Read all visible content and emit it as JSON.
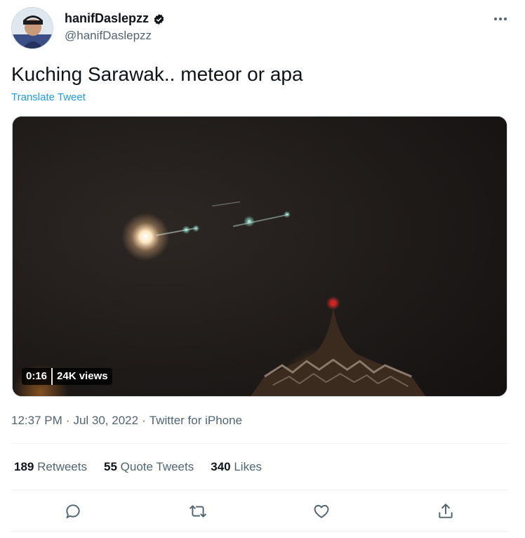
{
  "user": {
    "display_name": "hanifDaslepzz",
    "handle": "@hanifDaslepzz",
    "verified": true,
    "avatar_icon": "avatar-photo"
  },
  "tweet": {
    "text": "Kuching Sarawak.. meteor or apa",
    "translate_label": "Translate Tweet"
  },
  "media": {
    "duration": "0:16",
    "views": "24K views"
  },
  "meta": {
    "time": "12:37 PM",
    "separator1": "·",
    "date": "Jul 30, 2022",
    "separator2": "·",
    "source": "Twitter for iPhone"
  },
  "stats": [
    {
      "count": "189",
      "label": "Retweets"
    },
    {
      "count": "55",
      "label": "Quote Tweets"
    },
    {
      "count": "340",
      "label": "Likes"
    }
  ],
  "actions": [
    "reply-icon",
    "retweet-icon",
    "like-icon",
    "share-icon"
  ],
  "colors": {
    "accent": "#1d9bf0",
    "text": "#0f1419",
    "secondary": "#536471"
  }
}
